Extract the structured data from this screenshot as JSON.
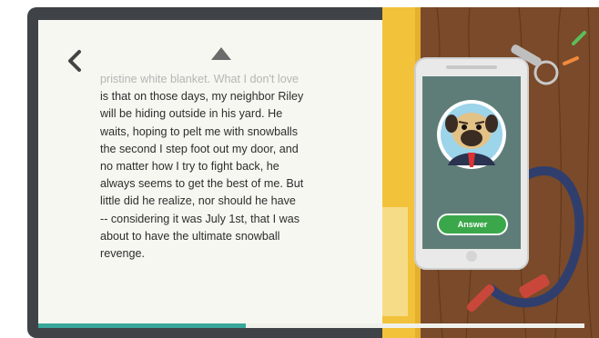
{
  "book": {
    "lines": [
      "pristine white blanket. What I don't love",
      "is that on those days, my neighbor Riley",
      "will be hiding outside in his yard. He",
      "waits, hoping to pelt me with snowballs",
      "the second I step foot out my door, and",
      "no matter how I try to fight back, he",
      "always seems to get the best of me. But",
      "little did he realize, nor should he have",
      "-- considering it was July 1st, that I was",
      "about to have the ultimate snowball",
      "revenge."
    ]
  },
  "navigation": {
    "back_icon": "chevron-left-icon",
    "scroll_up_icon": "triangle-up-icon"
  },
  "progress": {
    "fraction": 0.38,
    "color": "#3aa79a"
  },
  "phone": {
    "answer_label": "Answer",
    "caller_icon": "pug-avatar-icon"
  },
  "colors": {
    "frame": "#3f4347",
    "page": "#f7f7f1",
    "table_wood": "#7a4a2a",
    "answer_button": "#3aa84a"
  }
}
